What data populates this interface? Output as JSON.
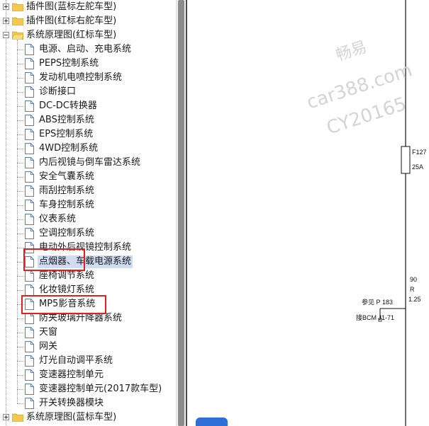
{
  "tree": {
    "folders": [
      {
        "label": "插件图(蓝标左舵车型)",
        "expanded": false
      },
      {
        "label": "插件图(红标右舵车型)",
        "expanded": false
      },
      {
        "label": "系统原理图(红标车型)",
        "expanded": true
      },
      {
        "label": "系统原理图(蓝标车型)",
        "expanded": false
      }
    ],
    "items": [
      "电源、启动、充电系统",
      "PEPS控制系统",
      "发动机电喷控制系统",
      "诊断接口",
      "DC-DC转换器",
      "ABS控制系统",
      "EPS控制系统",
      "4WD控制系统",
      "内后视镜与倒车雷达系统",
      "安全气囊系统",
      "雨刮控制系统",
      "车身控制系统",
      "仪表系统",
      "空调控制系统",
      "电动外后视镜控制系统",
      "点烟器、车载电源系统",
      "座椅调节系统",
      "化妆镜灯系统",
      "MP5影音系统",
      "防夹玻璃升降器系统",
      "天窗",
      "网关",
      "灯光自动调平系统",
      "变速器控制单元",
      "变速器控制单元(2017款车型)",
      "开关转换器模块"
    ],
    "selected_index": 15
  },
  "watermark": {
    "line1": "畅易",
    "line2": "car388.com",
    "line3": "CY20165"
  },
  "diagram": {
    "fuse_id": "F127",
    "fuse_rating": "25A",
    "wire_code": "90",
    "wire_color": "R",
    "wire_gauge": "1.25",
    "ref_page": "参见 P 183",
    "connector": "接BCM J1-71"
  },
  "colors": {
    "selection": "#cfdcf2",
    "highlight_box": "#e02020",
    "nav_button": "#2c6fd6"
  }
}
